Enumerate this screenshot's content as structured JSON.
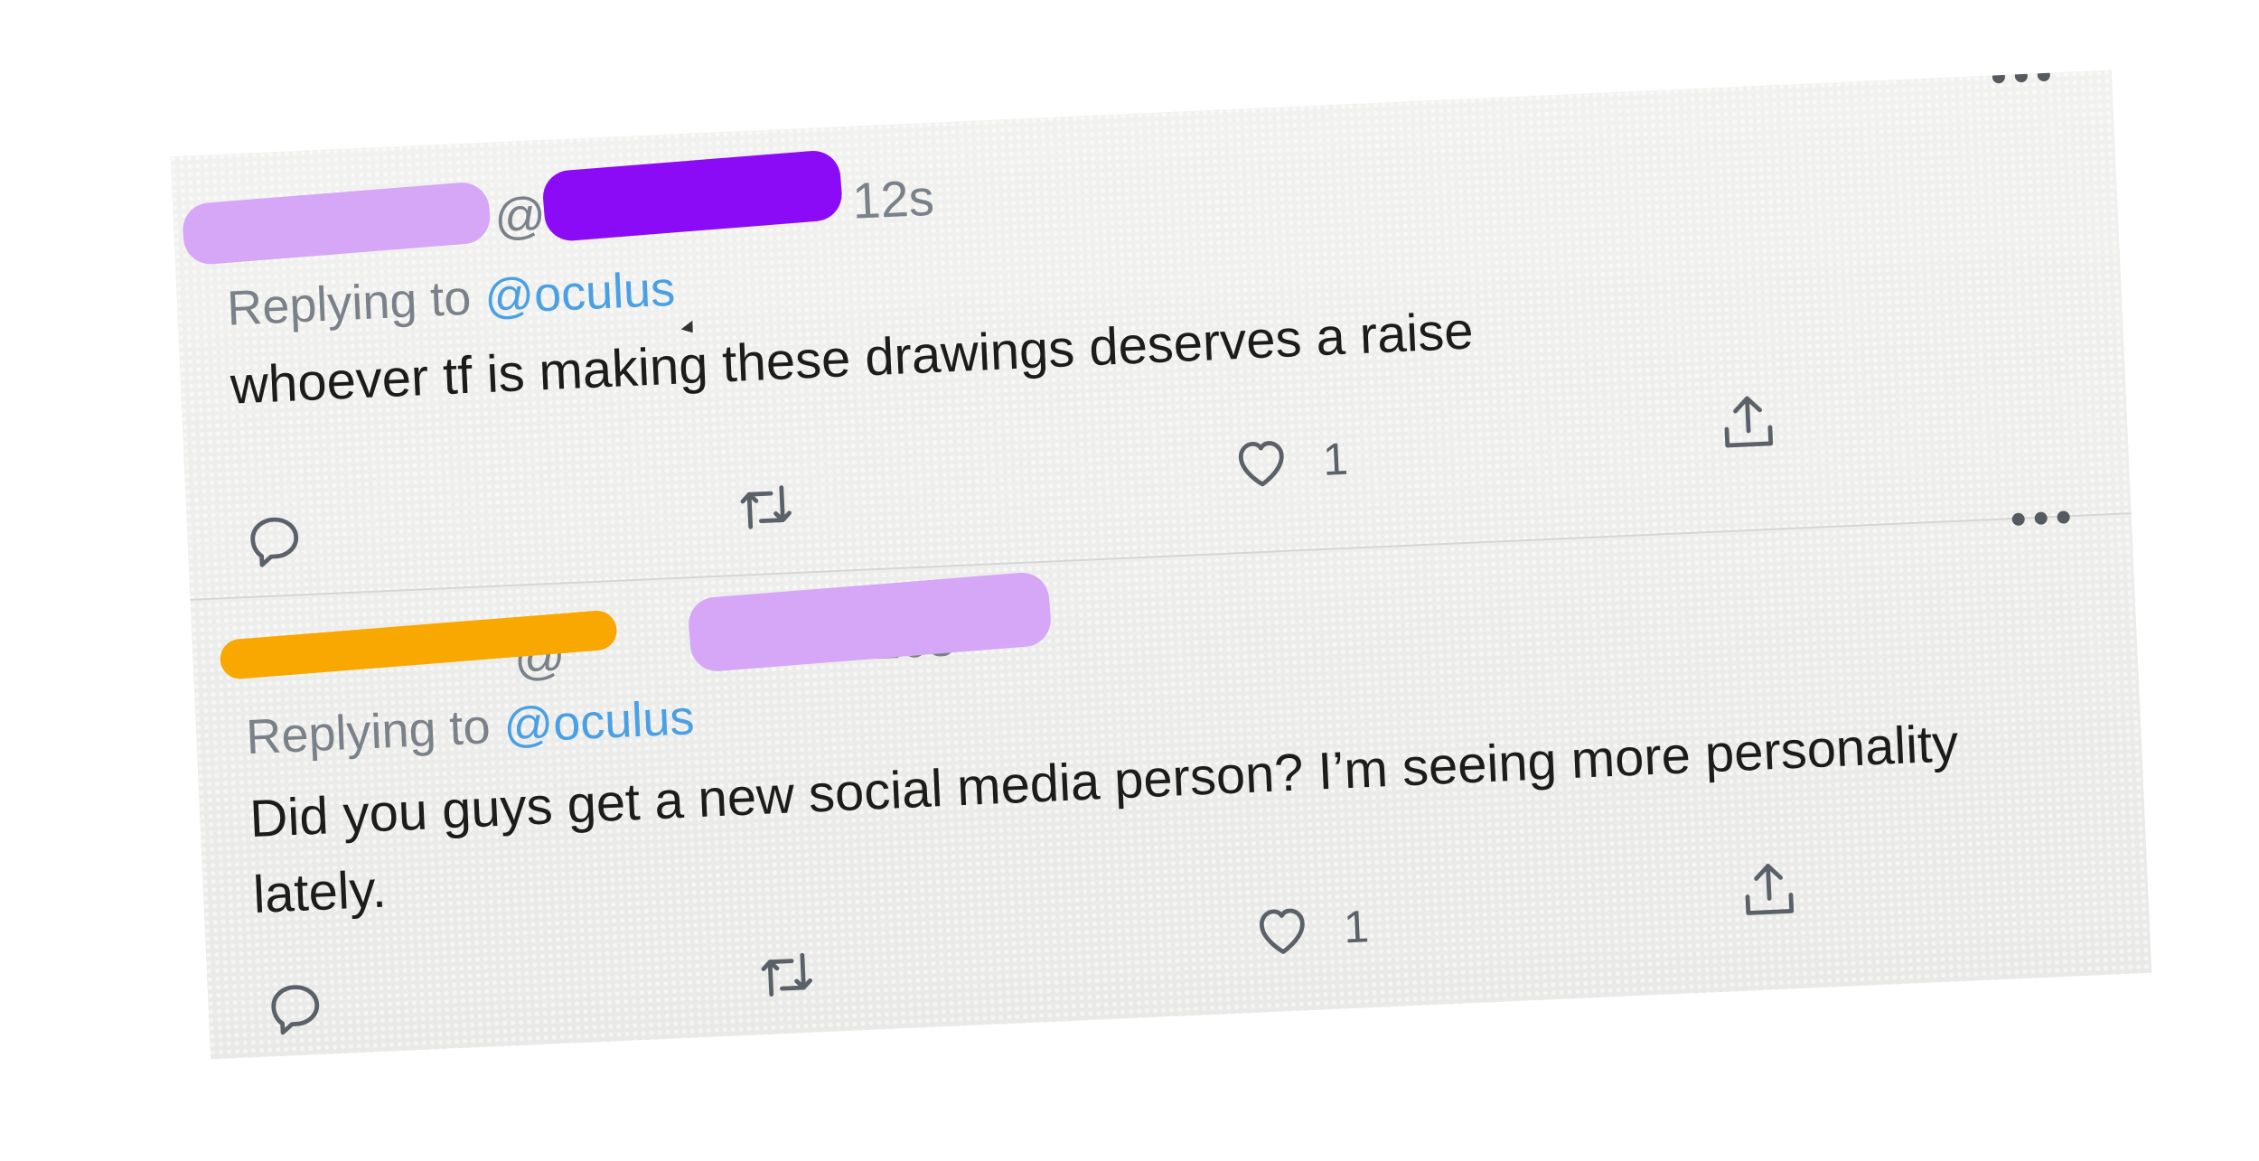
{
  "tweets": [
    {
      "name": "",
      "handle": "@",
      "time": "12s",
      "replying_label": "Replying to",
      "replying_to": "@oculus",
      "text": "whoever tf is making these drawings deserves a raise",
      "like_count": "1",
      "redactions": [
        "#d6a6f7",
        "#8b0bf7"
      ]
    },
    {
      "name": "",
      "handle": "@",
      "time": "20s",
      "replying_label": "Replying to",
      "replying_to": "@oculus",
      "text": "Did you guys get a new social media person? I’m seeing more personality lately.",
      "like_count": "1",
      "redactions": [
        "#f8a800",
        "#d6a6f7"
      ]
    }
  ],
  "separator": "·",
  "icons": [
    "more-icon",
    "reply-icon",
    "retweet-icon",
    "like-icon",
    "share-icon",
    "cursor-icon"
  ],
  "colors": {
    "link": "#4aa0e4",
    "secondary_text": "#7a8189",
    "primary_text": "#1c1c1c"
  }
}
